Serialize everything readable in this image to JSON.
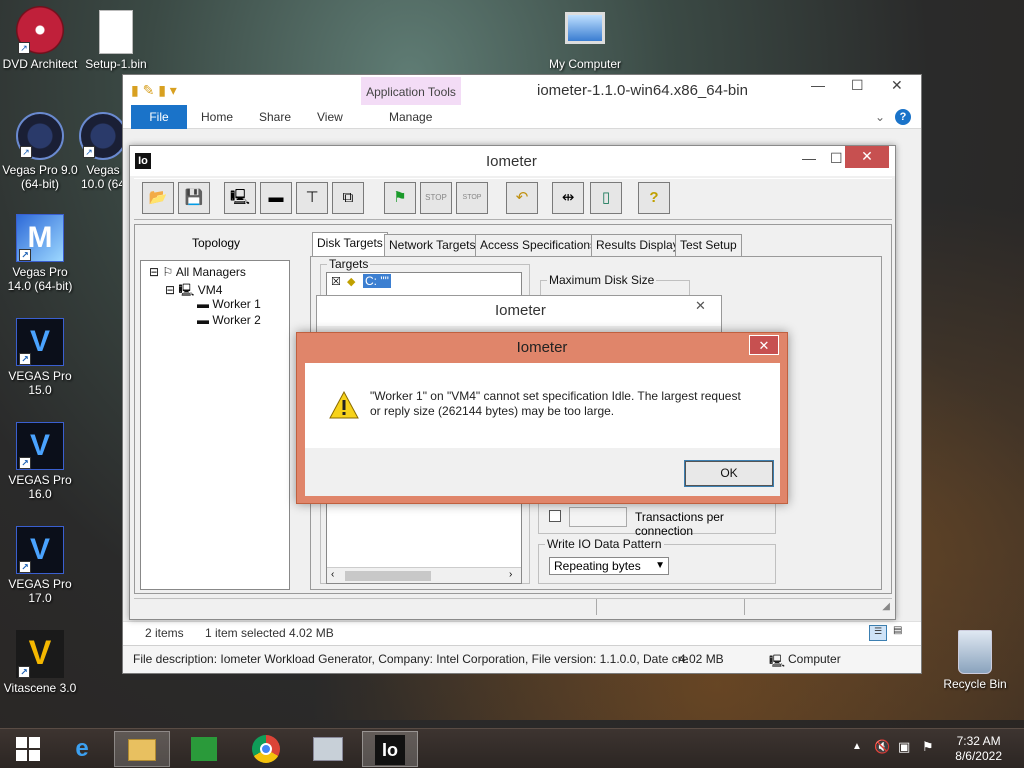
{
  "desktop": {
    "icons": [
      {
        "label": "DVD Architect"
      },
      {
        "label": "Setup-1.bin"
      },
      {
        "label": "My Computer"
      },
      {
        "label": "Vegas Pro 9.0 (64-bit)"
      },
      {
        "label": "Vegas 10.0 (64"
      },
      {
        "label": "Vegas Pro 14.0 (64-bit)"
      },
      {
        "label": "VEGAS Pro 15.0"
      },
      {
        "label": "VEGAS Pro 16.0"
      },
      {
        "label": "VEGAS Pro 17.0"
      },
      {
        "label": "Vitascene 3.0"
      },
      {
        "label": "Recycle Bin"
      }
    ]
  },
  "explorer": {
    "app_tools": "Application Tools",
    "title": "iometer-1.1.0-win64.x86_64-bin",
    "ribbon": {
      "file": "File",
      "home": "Home",
      "share": "Share",
      "view": "View",
      "manage": "Manage",
      "help": "?"
    },
    "status": {
      "items": "2 items",
      "selected": "1 item selected  4.02 MB"
    },
    "description": "File description: Iometer Workload Generator, Company: Intel Corporation, File version: 1.1.0.0, Date cre",
    "desc_size": "4.02 MB",
    "desc_location": "Computer"
  },
  "iometer": {
    "logo": "Io",
    "title": "Iometer",
    "topology_label": "Topology",
    "tree": {
      "root": "All Managers",
      "manager": "VM4",
      "workers": [
        "Worker 1",
        "Worker 2"
      ]
    },
    "tabs": [
      "Disk Targets",
      "Network Targets",
      "Access Specifications",
      "Results Display",
      "Test Setup"
    ],
    "targets_label": "Targets",
    "target_item": "C: \"\"",
    "max_disk_size_label": "Maximum Disk Size",
    "transactions_label": "Transactions per connection",
    "write_io_label": "Write IO Data Pattern",
    "write_io_value": "Repeating bytes"
  },
  "dialog2": {
    "title": "Iometer"
  },
  "error_dialog": {
    "title": "Iometer",
    "line1": "\"Worker 1\" on \"VM4\" cannot set specification Idle.  The largest request",
    "line2": "or reply size (262144 bytes) may be too large.",
    "ok": "OK"
  },
  "taskbar": {
    "time": "7:32 AM",
    "date": "8/6/2022",
    "iometer_label": "Io"
  },
  "colors": {
    "accent": "#1a73c9",
    "error_frame": "#e0856a",
    "close_red": "#c75050"
  }
}
